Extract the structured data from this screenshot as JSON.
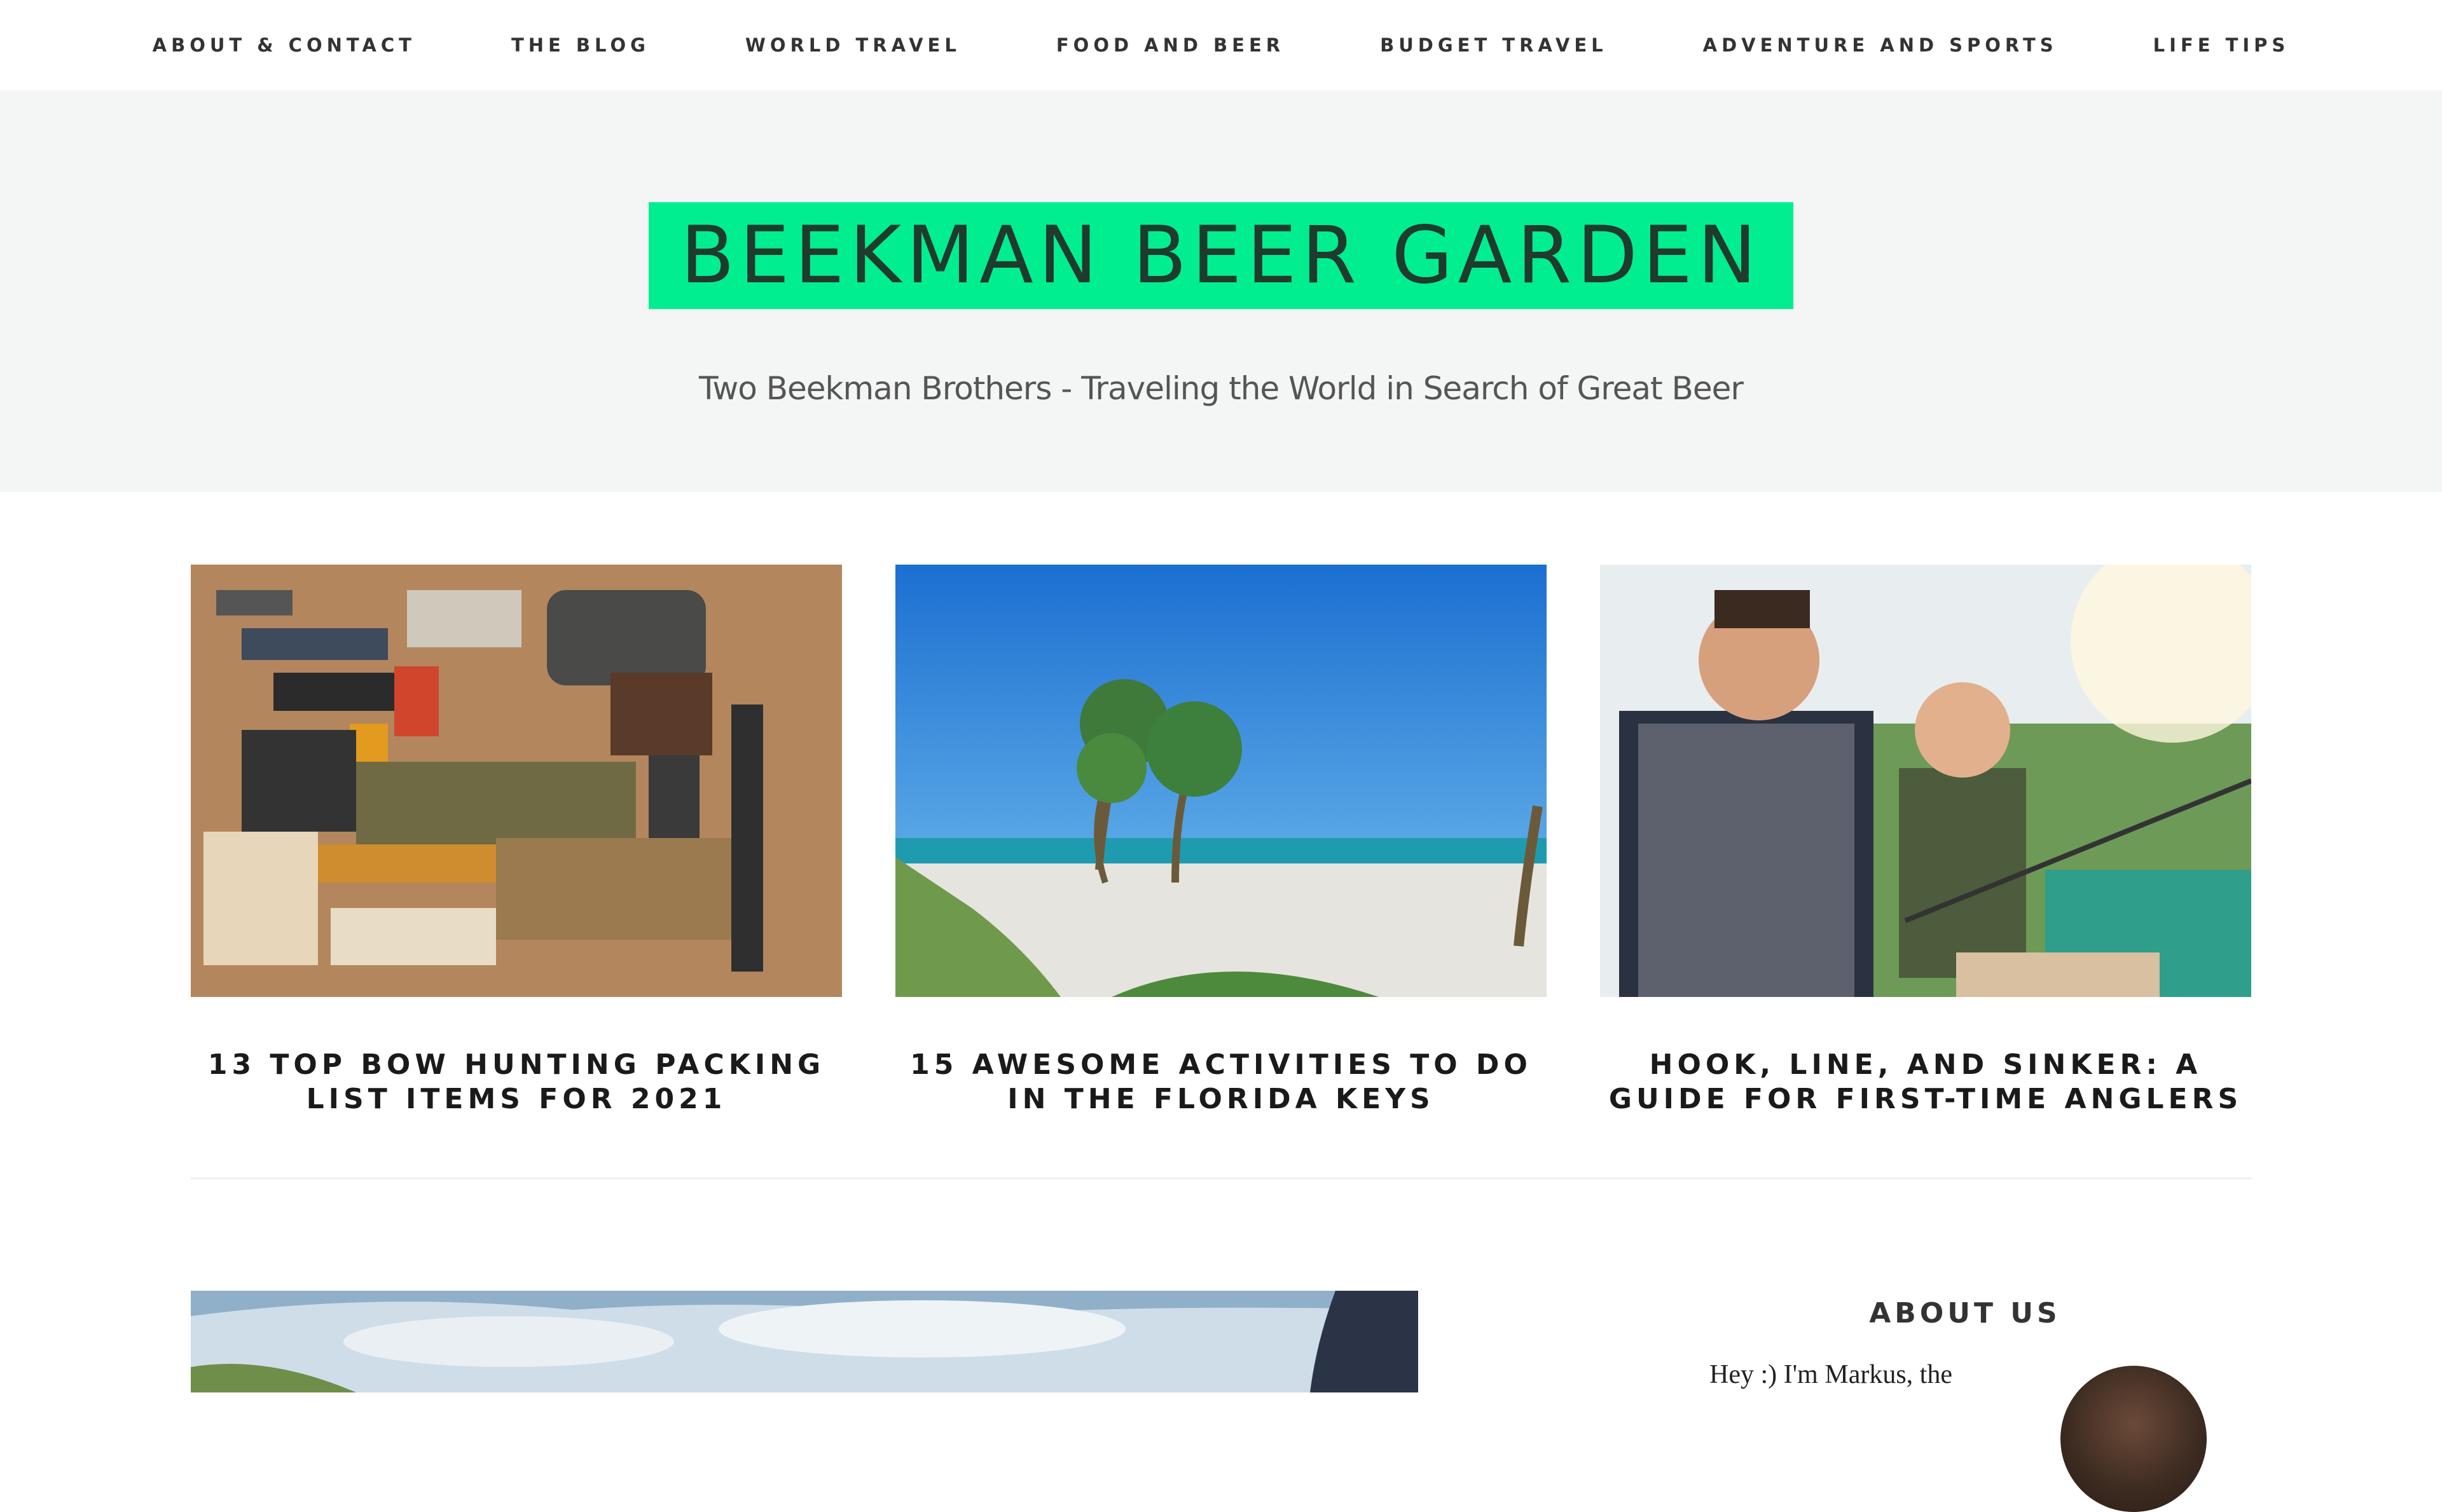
{
  "nav": {
    "items": [
      {
        "label": "ABOUT & CONTACT"
      },
      {
        "label": "THE BLOG"
      },
      {
        "label": "WORLD TRAVEL"
      },
      {
        "label": "FOOD AND BEER"
      },
      {
        "label": "BUDGET TRAVEL"
      },
      {
        "label": "ADVENTURE AND SPORTS"
      },
      {
        "label": "LIFE TIPS"
      }
    ]
  },
  "header": {
    "title": "BEEKMAN BEER GARDEN",
    "tagline": "Two Beekman Brothers - Traveling the World in Search of Great Beer"
  },
  "featured": [
    {
      "title": "13 TOP BOW HUNTING PACKING LIST ITEMS FOR 2021",
      "image_icon": "gear-layout-photo"
    },
    {
      "title": "15 AWESOME ACTIVITIES TO DO IN THE FLORIDA KEYS",
      "image_icon": "beach-palm-photo"
    },
    {
      "title": "HOOK, LINE, AND SINKER: A GUIDE FOR FIRST-TIME ANGLERS",
      "image_icon": "fishing-men-photo"
    }
  ],
  "sidebar": {
    "widget_title": "ABOUT US",
    "about_text": "Hey :) I'm Markus, the"
  },
  "colors": {
    "title_bg": "#00ee8f",
    "header_bg": "#f4f5f5",
    "text": "#222222"
  }
}
